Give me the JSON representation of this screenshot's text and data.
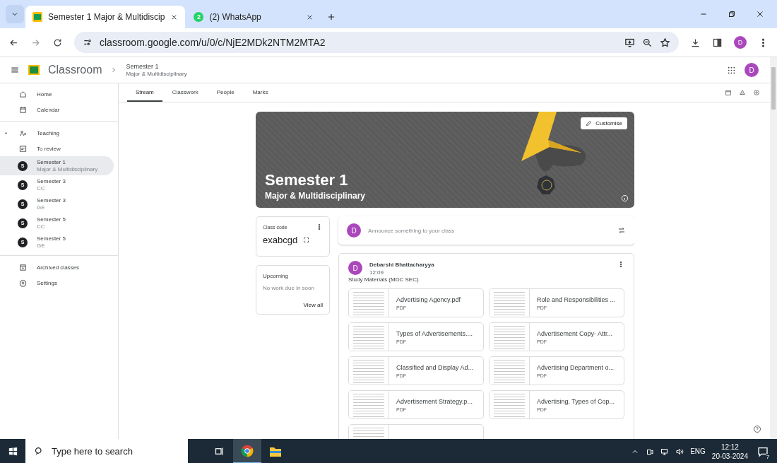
{
  "browser": {
    "tabs": [
      {
        "title": "Semester 1 Major & Multidiscip",
        "selected": true
      },
      {
        "title": "(2) WhatsApp",
        "badge": "2",
        "selected": false
      }
    ],
    "url": "classroom.google.com/u/0/c/NjE2MDk2NTM2MTA2",
    "profile_initial": "D"
  },
  "app_bar": {
    "product": "Classroom",
    "class_title": "Semester 1",
    "class_subtitle": "Major & Multidisciplinary",
    "avatar": "D"
  },
  "page_tabs": [
    {
      "label": "Stream",
      "selected": true
    },
    {
      "label": "Classwork",
      "selected": false
    },
    {
      "label": "People",
      "selected": false
    },
    {
      "label": "Marks",
      "selected": false
    }
  ],
  "sidebar": {
    "items": [
      {
        "kind": "home",
        "label": "Home",
        "selected": false
      },
      {
        "kind": "calendar",
        "label": "Calendar",
        "selected": false
      },
      {
        "kind": "divider"
      },
      {
        "kind": "teaching",
        "label": "Teaching",
        "expanded": true,
        "selected": false
      },
      {
        "kind": "review",
        "label": "To review",
        "selected": false
      },
      {
        "kind": "class",
        "letter": "S",
        "label": "Semester 1",
        "subtitle": "Major & Multidisciplinary",
        "selected": true
      },
      {
        "kind": "class",
        "letter": "S",
        "label": "Semester 3",
        "subtitle": "CC",
        "selected": false
      },
      {
        "kind": "class",
        "letter": "S",
        "label": "Semester 3",
        "subtitle": "GE",
        "selected": false
      },
      {
        "kind": "class",
        "letter": "S",
        "label": "Semester 5",
        "subtitle": "CC",
        "selected": false
      },
      {
        "kind": "class",
        "letter": "S",
        "label": "Semester 5",
        "subtitle": "GE",
        "selected": false
      },
      {
        "kind": "divider"
      },
      {
        "kind": "archive",
        "label": "Archived classes",
        "selected": false
      },
      {
        "kind": "settings",
        "label": "Settings",
        "selected": false
      }
    ]
  },
  "banner": {
    "title": "Semester 1",
    "subtitle": "Major & Multidisciplinary",
    "button": "Customise"
  },
  "class_code": {
    "label": "Class code",
    "code": "exabcgd"
  },
  "upcoming": {
    "title": "Upcoming",
    "note": "No work due in soon",
    "link": "View all"
  },
  "announce": {
    "avatar": "D",
    "placeholder": "Announce something to your class"
  },
  "post": {
    "avatar": "D",
    "author": "Debarshi Bhattacharyya",
    "time": "12:09",
    "text": "Study Materials (MDC SEC)",
    "attachments": [
      {
        "kind": "file",
        "title": "Advertising Agency.pdf",
        "type": "PDF"
      },
      {
        "kind": "file",
        "title": "Role and Responsibilities ...",
        "type": "PDF"
      },
      {
        "kind": "file",
        "title": "Types of Advertisements....",
        "type": "PDF"
      },
      {
        "kind": "file",
        "title": "Advertisement Copy- Attr...",
        "type": "PDF"
      },
      {
        "kind": "file",
        "title": "Classified and Display Ad...",
        "type": "PDF"
      },
      {
        "kind": "file",
        "title": "Advertising Department o...",
        "type": "PDF"
      },
      {
        "kind": "file",
        "title": "Advertisement Strategy.p...",
        "type": "PDF"
      },
      {
        "kind": "file",
        "title": "Advertising, Types of Cop...",
        "type": "PDF"
      },
      {
        "kind": "cut"
      }
    ]
  },
  "taskbar": {
    "search_placeholder": "Type here to search",
    "language": "ENG",
    "time": "12:12",
    "date": "20-03-2024",
    "notifications": "7"
  }
}
